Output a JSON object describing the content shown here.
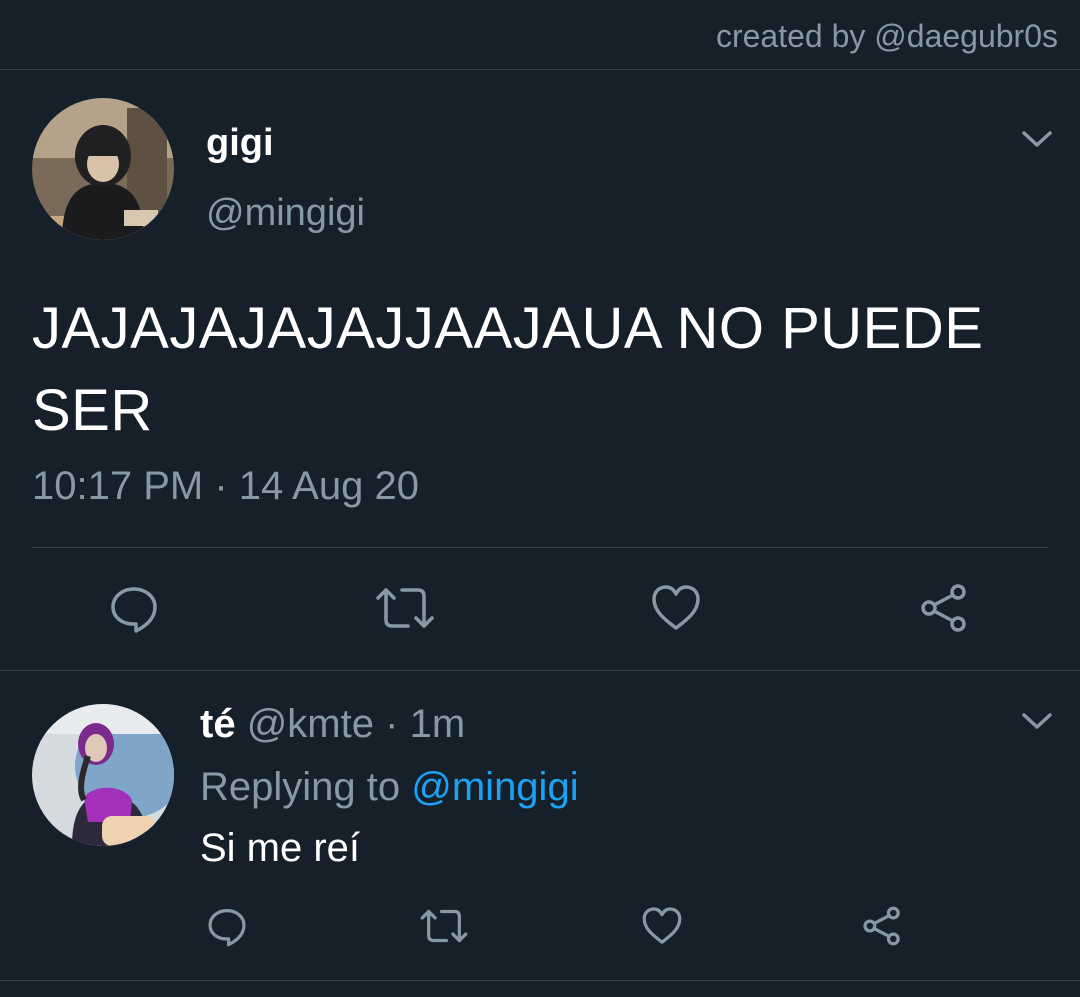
{
  "credit": "created by @daegubr0s",
  "tweet": {
    "display_name": "gigi",
    "handle": "@mingigi",
    "text": "JAJAJAJAJAJJAAJAUA NO PUEDE SER",
    "timestamp": "10:17 PM · 14 Aug 20"
  },
  "reply": {
    "display_name": "té",
    "handle": "@kmte",
    "separator": "·",
    "time": "1m",
    "replying_prefix": "Replying to",
    "replying_mention": "@mingigi",
    "text": "Si me reí"
  },
  "icons": {
    "reply": "reply-icon",
    "retweet": "retweet-icon",
    "like": "heart-icon",
    "share": "share-icon",
    "more": "chevron-down-icon"
  },
  "colors": {
    "background": "#15202b",
    "text_primary": "#ffffff",
    "text_secondary": "#8899a6",
    "accent": "#1da1f2",
    "divider": "#38444d"
  }
}
